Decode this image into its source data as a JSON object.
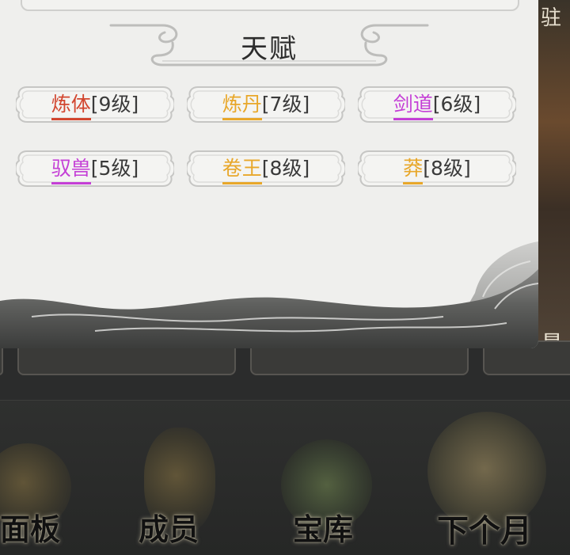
{
  "modal": {
    "title": "天赋",
    "talents": [
      {
        "name": "炼体",
        "level": "[9级]",
        "color": "#d2462f"
      },
      {
        "name": "炼丹",
        "level": "[7级]",
        "color": "#e8a72a"
      },
      {
        "name": "剑道",
        "level": "[6级]",
        "color": "#c43fd6"
      },
      {
        "name": "驭兽",
        "level": "[5级]",
        "color": "#c43fd6"
      },
      {
        "name": "卷王",
        "level": "[8级]",
        "color": "#e8a72a"
      },
      {
        "name": "莽",
        "level": "[8级]",
        "color": "#e8a72a"
      }
    ]
  },
  "background": {
    "right_edge_char": "驻",
    "right_edge_char2": "悬"
  },
  "bottom_nav": {
    "items": [
      {
        "label": "面板"
      },
      {
        "label": "成员"
      },
      {
        "label": "宝库"
      },
      {
        "label": "下个月"
      }
    ]
  }
}
